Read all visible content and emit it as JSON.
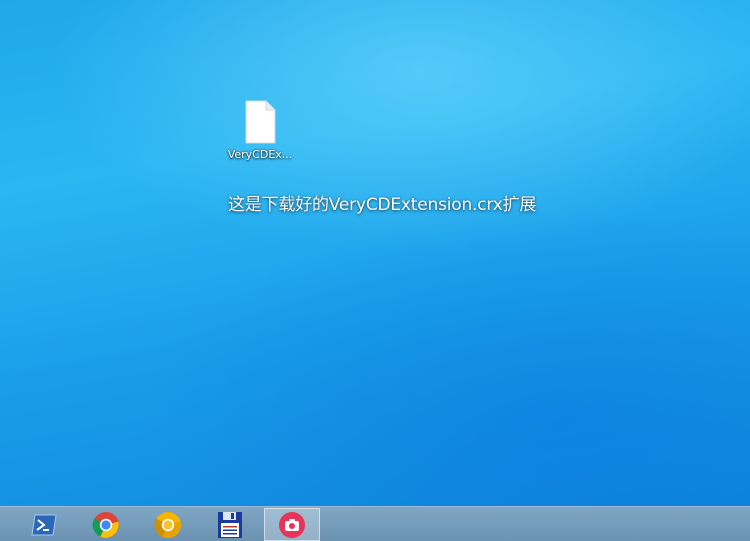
{
  "desktop": {
    "icon": {
      "name": "file-icon",
      "label": "VeryCDEx..."
    },
    "caption": "这是下载好的VeryCDExtension.crx扩展"
  },
  "taskbar": {
    "items": [
      {
        "icon": "powershell-icon",
        "active": false
      },
      {
        "icon": "chrome-icon",
        "active": false
      },
      {
        "icon": "chrome-canary-icon",
        "active": false
      },
      {
        "icon": "floppy-disk-icon",
        "active": false
      },
      {
        "icon": "camera-icon",
        "active": true
      }
    ]
  },
  "colors": {
    "desktop_blue": "#1fa7ea",
    "taskbar": "#7fa6c4",
    "camera_red": "#e8345a"
  }
}
